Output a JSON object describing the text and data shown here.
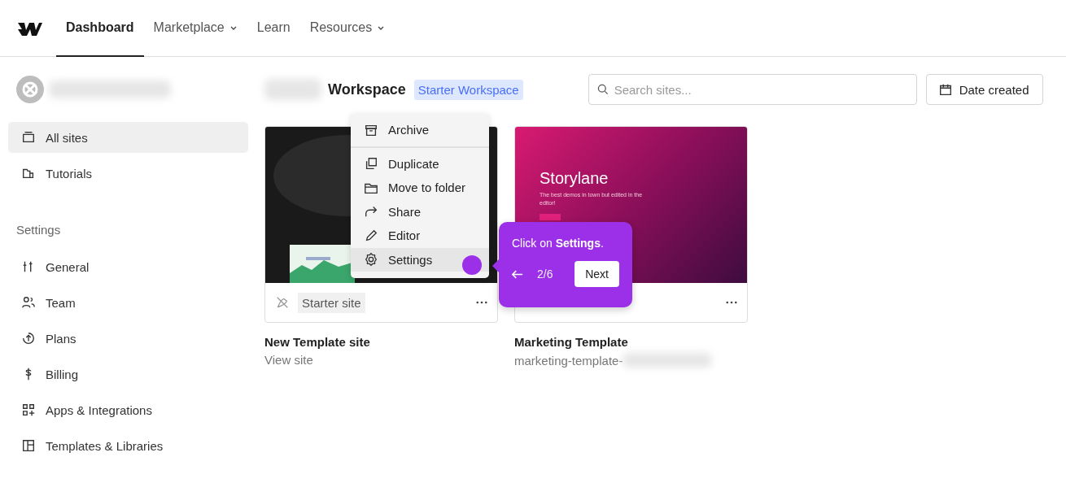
{
  "nav": {
    "tabs": [
      {
        "label": "Dashboard",
        "selected": true,
        "dropdown": false
      },
      {
        "label": "Marketplace",
        "selected": false,
        "dropdown": true
      },
      {
        "label": "Learn",
        "selected": false,
        "dropdown": false
      },
      {
        "label": "Resources",
        "selected": false,
        "dropdown": true
      }
    ]
  },
  "sidebar": {
    "items": [
      {
        "label": "All sites",
        "selected": true
      },
      {
        "label": "Tutorials",
        "selected": false
      }
    ],
    "section_title": "Settings",
    "settings_items": [
      {
        "label": "General",
        "selected": false
      },
      {
        "label": "Team",
        "selected": false
      },
      {
        "label": "Plans",
        "selected": false
      },
      {
        "label": "Billing",
        "selected": false
      },
      {
        "label": "Apps & Integrations",
        "selected": false
      },
      {
        "label": "Templates & Libraries",
        "selected": false
      }
    ]
  },
  "workspace": {
    "title": "Workspace",
    "badge": "Starter Workspace"
  },
  "search": {
    "placeholder": "Search sites..."
  },
  "sort_button": {
    "label": "Date created"
  },
  "sites": [
    {
      "name": "New Template site",
      "link": "View site",
      "tag": "Starter site",
      "kind": "dark"
    },
    {
      "name": "Marketing Template",
      "link": "marketing-template-",
      "kind": "magenta",
      "preview_title": "Storylane",
      "preview_text": "The best demos in town but edited in the editor!"
    }
  ],
  "context_menu": {
    "groups": [
      {
        "items": [
          {
            "label": "Archive",
            "highlighted": false
          }
        ]
      },
      {
        "items": [
          {
            "label": "Duplicate",
            "highlighted": false
          },
          {
            "label": "Move to folder",
            "highlighted": false
          },
          {
            "label": "Share",
            "highlighted": false
          },
          {
            "label": "Editor",
            "highlighted": false
          },
          {
            "label": "Settings",
            "highlighted": true
          }
        ]
      }
    ]
  },
  "tour": {
    "text": "Click on **Settings**.",
    "step": "2/6",
    "next": "Next"
  }
}
